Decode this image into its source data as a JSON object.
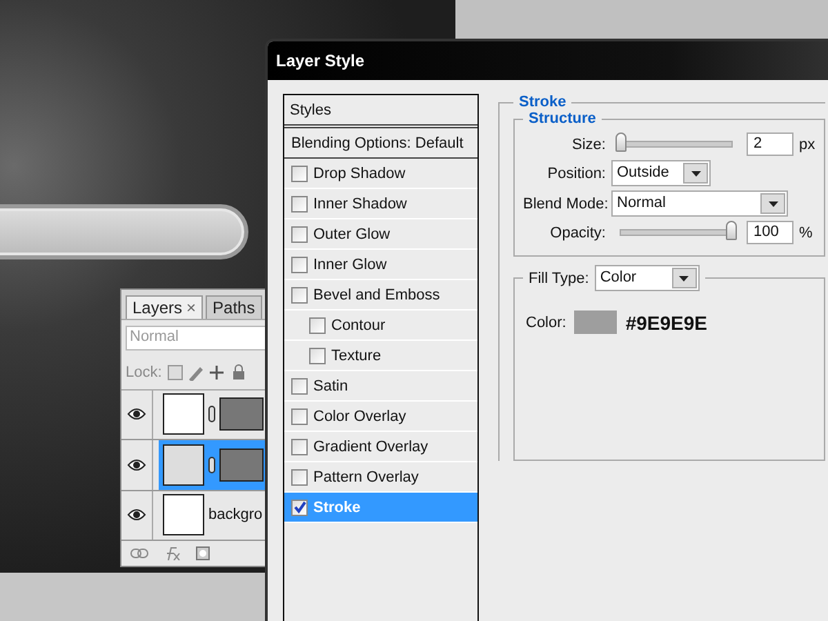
{
  "layers_panel": {
    "tabs": [
      {
        "label": "Layers",
        "close": "×",
        "selected": true
      },
      {
        "label": "Paths",
        "selected": false
      }
    ],
    "blend_mode": {
      "value": "Normal",
      "disabled": true
    },
    "lock_label": "Lock:",
    "layers": [
      {
        "kind": "shape",
        "visible": true,
        "selected": false
      },
      {
        "kind": "shape",
        "visible": true,
        "selected": true
      },
      {
        "kind": "plain",
        "name": "backgro",
        "visible": true,
        "selected": false
      }
    ]
  },
  "dialog": {
    "title": "Layer Style",
    "styles_header": "Styles",
    "blending_options": "Blending Options: Default",
    "styles": [
      {
        "label": "Drop Shadow",
        "checked": false,
        "selected": false
      },
      {
        "label": "Inner Shadow",
        "checked": false,
        "selected": false
      },
      {
        "label": "Outer Glow",
        "checked": false,
        "selected": false
      },
      {
        "label": "Inner Glow",
        "checked": false,
        "selected": false
      },
      {
        "label": "Bevel and Emboss",
        "checked": false,
        "selected": false,
        "children": [
          {
            "label": "Contour",
            "checked": false,
            "selected": false
          },
          {
            "label": "Texture",
            "checked": false,
            "selected": false
          }
        ]
      },
      {
        "label": "Satin",
        "checked": false,
        "selected": false
      },
      {
        "label": "Color Overlay",
        "checked": false,
        "selected": false
      },
      {
        "label": "Gradient Overlay",
        "checked": false,
        "selected": false
      },
      {
        "label": "Pattern Overlay",
        "checked": false,
        "selected": false
      },
      {
        "label": "Stroke",
        "checked": true,
        "selected": true
      }
    ],
    "stroke": {
      "legend": "Stroke",
      "structure_legend": "Structure",
      "size": {
        "label": "Size:",
        "level": 0.0,
        "value": "2",
        "unit": "px"
      },
      "position": {
        "label": "Position:",
        "value": "Outside"
      },
      "blend_mode": {
        "label": "Blend Mode:",
        "value": "Normal"
      },
      "opacity": {
        "label": "Opacity:",
        "level": 1.0,
        "value": "100",
        "unit": "%"
      },
      "fill_type": {
        "label": "Fill Type:",
        "value": "Color"
      },
      "color": {
        "label": "Color:",
        "color": "#9e9e9e",
        "hex": "#9E9E9E"
      }
    }
  }
}
